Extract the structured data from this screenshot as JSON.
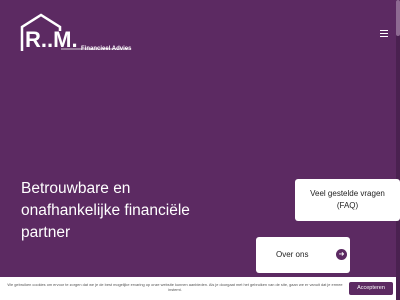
{
  "logo": {
    "text": "R..M.",
    "subtitle": "Financieel Advies"
  },
  "menu": {
    "icon": "hamburger-menu-icon"
  },
  "hero": {
    "line1": "Betrouwbare en",
    "line2": "onafhankelijke financiële",
    "line3": "partner"
  },
  "faq_card": {
    "line1": "Veel gestelde vragen",
    "line2": "(FAQ)"
  },
  "about_card": {
    "label": "Over ons",
    "icon": "arrow-right-icon",
    "arrow": "➜"
  },
  "cookie_banner": {
    "text": "We gebruiken cookies om ervoor te zorgen dat we je de best mogelijke ervaring op onze website kunnen aanbieden. Als je doorgaat met het gebruiken van de site, gaan we er vanuit dat je ermee instemt.",
    "accept_label": "Accepteren"
  },
  "colors": {
    "background": "#5c2a62",
    "card": "#ffffff"
  }
}
